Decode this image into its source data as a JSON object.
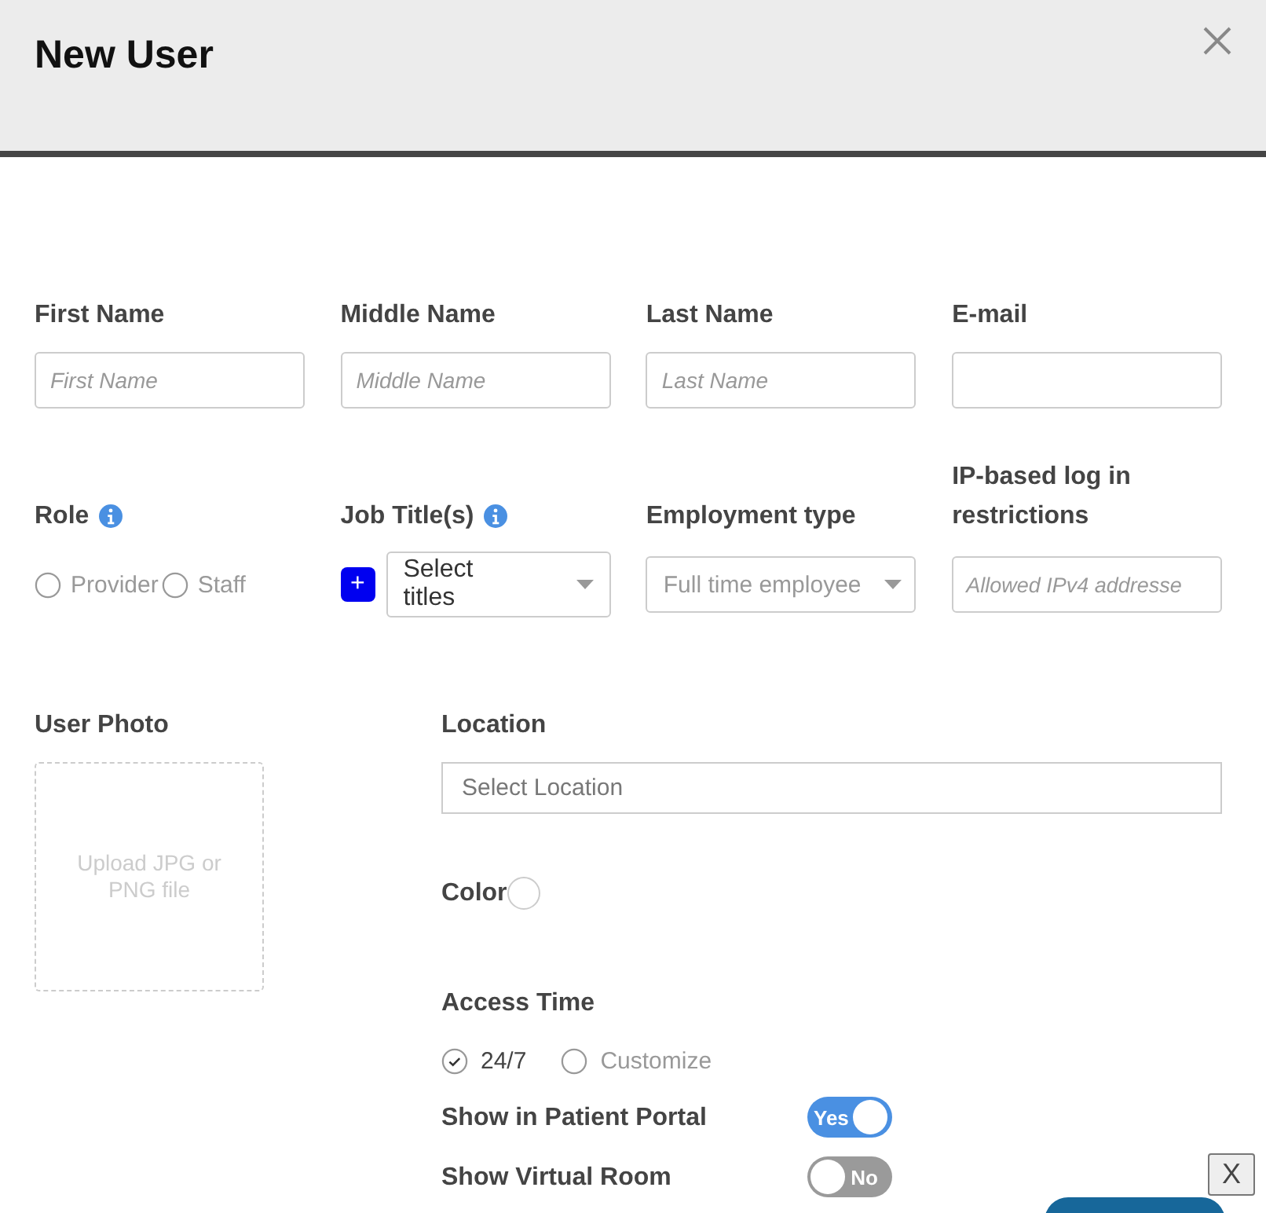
{
  "window": {
    "title": "New User"
  },
  "row_1": [
    {
      "label": "First Name",
      "kind": "text",
      "placeholder": "First Name"
    },
    {
      "label": "Middle Name",
      "kind": "text",
      "placeholder": "Middle Name"
    },
    {
      "label": "Last Name",
      "kind": "text",
      "placeholder": "Last Name"
    },
    {
      "label": "E-mail",
      "kind": "text"
    }
  ],
  "row_2": [
    {
      "label": "Role",
      "info": true,
      "kind": "radio",
      "options": [
        {
          "label": "Provider",
          "selected": false
        },
        {
          "label": "Staff",
          "selected": false
        }
      ]
    },
    {
      "label": "Job Title(s)",
      "info": true,
      "kind": "multiselect",
      "add": "+",
      "value": "Select titles"
    },
    {
      "label": "Employment type",
      "info": false,
      "kind": "select",
      "value": "Full time employee"
    },
    {
      "label": "IP-based log in restrictions",
      "info": false,
      "kind": "text",
      "placeholder": "Allowed IPv4 addresse"
    }
  ],
  "photo": {
    "label": "User Photo",
    "hint": "Upload JPG or PNG file"
  },
  "location": {
    "label": "Location",
    "placeholder": "Select Location"
  },
  "color": {
    "label": "Color"
  },
  "access_time": {
    "label": "Access Time",
    "options": [
      {
        "label": "24/7",
        "selected": true
      },
      {
        "label": "Customize",
        "selected": false
      }
    ]
  },
  "toggles": [
    {
      "label": "Show in Patient Portal",
      "on": true,
      "text": "Yes"
    },
    {
      "label": "Show Virtual Room",
      "on": false,
      "text": "No"
    }
  ],
  "dismiss": "X"
}
